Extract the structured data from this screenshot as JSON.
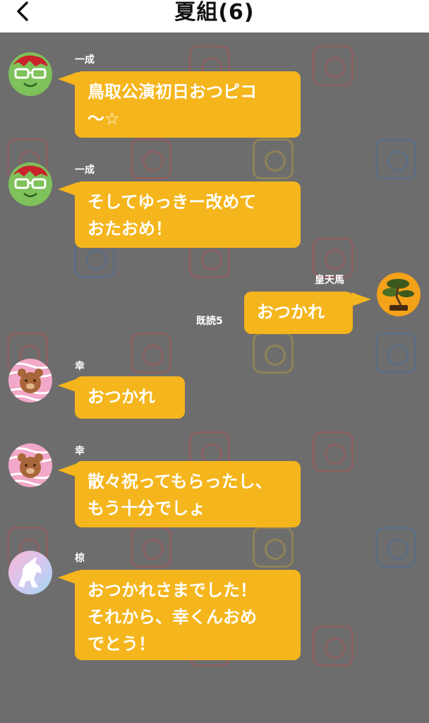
{
  "header": {
    "title": "夏組(6)",
    "back_icon": "chevron-left-icon"
  },
  "messages": [
    {
      "sender": "一成",
      "text": "鳥取公演初日おつピコ\n〜☆",
      "side": "left",
      "avatar": "green-glasses-avatar"
    },
    {
      "sender": "一成",
      "text": "そしてゆっきー改めて\nおたおめ！",
      "side": "left",
      "avatar": "green-glasses-avatar"
    },
    {
      "sender": "皇天馬",
      "text": "おつかれ",
      "side": "right",
      "read": "既読5",
      "avatar": "bonsai-avatar"
    },
    {
      "sender": "幸",
      "text": "おつかれ",
      "side": "left",
      "avatar": "bear-avatar"
    },
    {
      "sender": "幸",
      "text": "散々祝ってもらったし、\nもう十分でしょ",
      "side": "left",
      "avatar": "bear-avatar"
    },
    {
      "sender": "椋",
      "text": "おつかれさまでした！\nそれから、幸くんおめ\nでとう！",
      "side": "left",
      "avatar": "unicorn-avatar"
    }
  ],
  "colors": {
    "background": "#6d6d6d",
    "bubble": "#f5b51c",
    "header_bg": "#ffffff"
  }
}
